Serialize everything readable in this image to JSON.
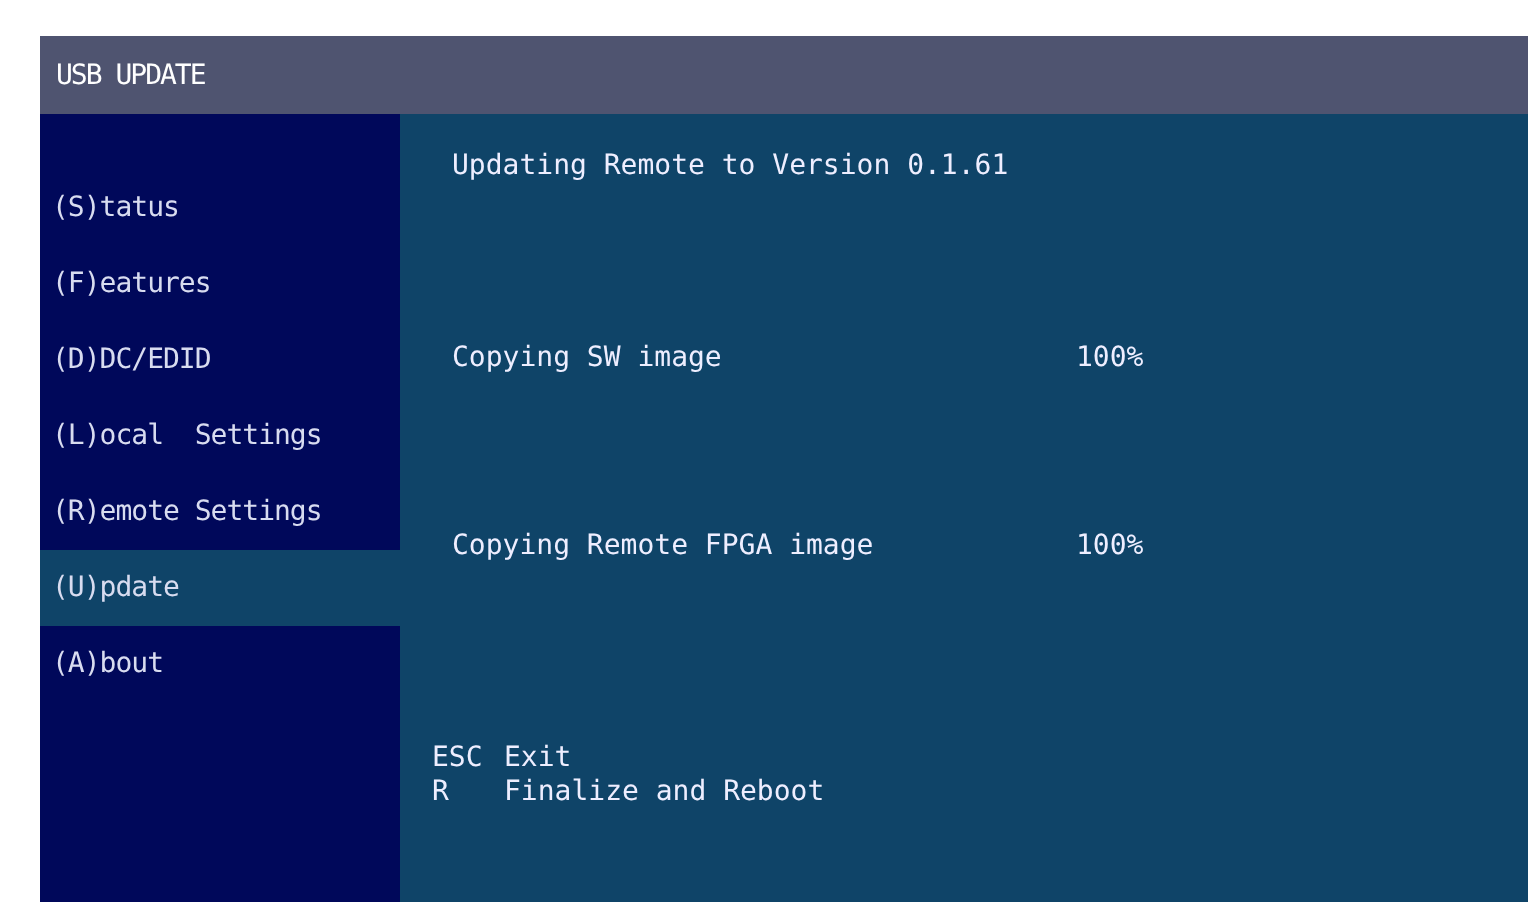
{
  "window": {
    "title": "USB UPDATE"
  },
  "sidebar": {
    "items": [
      {
        "label": "(S)tatus",
        "selected": false
      },
      {
        "label": "(F)eatures",
        "selected": false
      },
      {
        "label": "(D)DC/EDID",
        "selected": false
      },
      {
        "label": "(L)ocal  Settings",
        "selected": false
      },
      {
        "label": "(R)emote Settings",
        "selected": false
      },
      {
        "label": "(U)pdate",
        "selected": true
      },
      {
        "label": "(A)bout",
        "selected": false
      }
    ]
  },
  "content": {
    "heading": "Updating Remote to Version 0.1.61",
    "tasks": [
      {
        "label": "Copying SW image",
        "progress": "100%"
      },
      {
        "label": "Copying Remote FPGA image",
        "progress": "100%"
      }
    ],
    "hints": [
      {
        "key": "ESC",
        "action": "Exit"
      },
      {
        "key": "R",
        "action": "Finalize and Reboot"
      }
    ]
  }
}
